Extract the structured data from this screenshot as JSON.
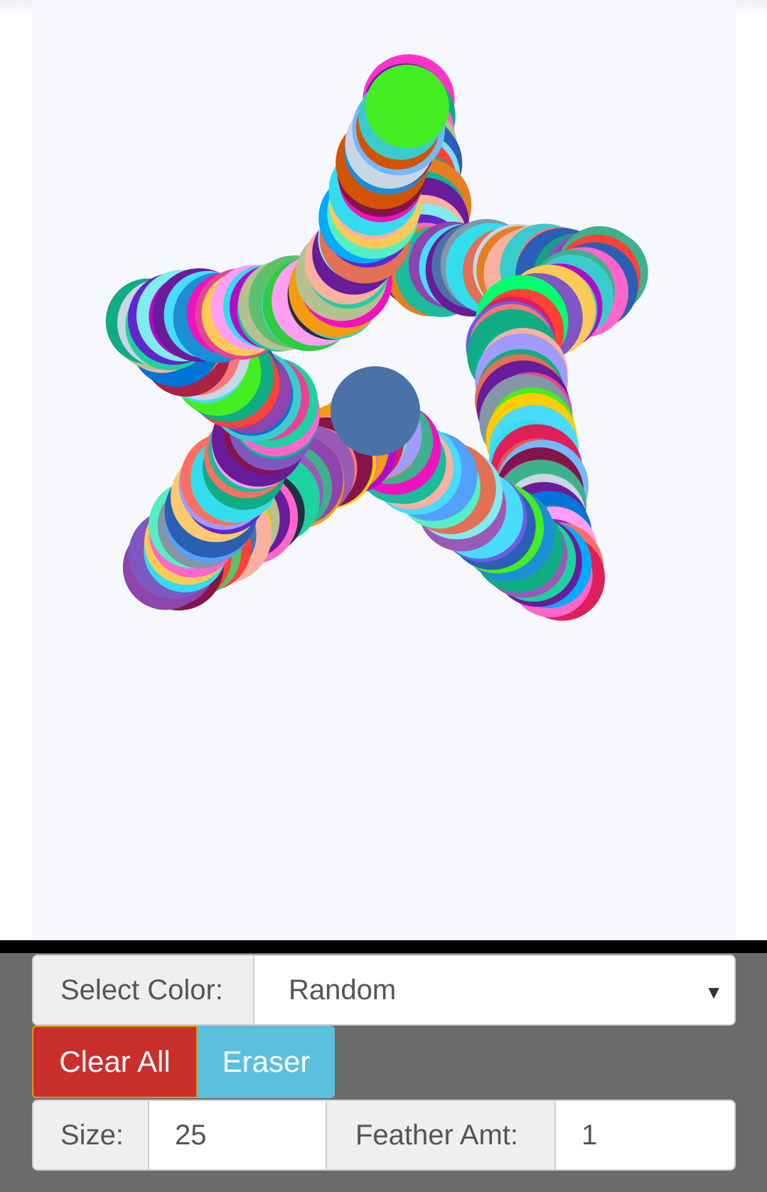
{
  "color_label": "Select Color:",
  "color_value": "Random",
  "clear_label": "Clear All",
  "eraser_label": "Eraser",
  "size_label": "Size:",
  "size_value": "25",
  "feather_label": "Feather Amt:",
  "feather_value": "1",
  "colors": {
    "canvas_bg": "#f7f8fd",
    "panel_bg": "#6b6b6b",
    "clear_button": "#c9302c",
    "eraser_button": "#5bc0de"
  },
  "drawing": {
    "shape": "star",
    "palette": [
      "#6a1b9a",
      "#b5c18e",
      "#5cc16a",
      "#44ee22",
      "#1a8fd6",
      "#ff33cc",
      "#2a5fb3",
      "#e01e5a",
      "#7e57c2",
      "#3fb08c",
      "#ff66cc",
      "#00c896",
      "#33ddee",
      "#aa2244",
      "#8e44ad",
      "#00aaff",
      "#ffcc00",
      "#e67e22",
      "#4a72a8",
      "#1abc9c",
      "#ff6f61",
      "#2ecc40",
      "#c0392b",
      "#9b59b6",
      "#f39c12",
      "#16a085",
      "#d35400",
      "#7fdbff",
      "#ff4136",
      "#b10dc9",
      "#01ff70",
      "#85144b",
      "#3d9970",
      "#f012be",
      "#39cccc",
      "#0074d9",
      "#e84393",
      "#6c5ce7",
      "#00b894",
      "#fdcb6e",
      "#e17055",
      "#a29bfe",
      "#55efc4",
      "#fab1a0",
      "#81ecec",
      "#ff7675",
      "#74b9ff",
      "#c8d6e5",
      "#222f3e",
      "#ee5253",
      "#10ac84",
      "#5f27cd",
      "#ff9ff3",
      "#48dbfb",
      "#1dd1a1",
      "#feca57",
      "#54a0ff",
      "#8395a7"
    ]
  }
}
